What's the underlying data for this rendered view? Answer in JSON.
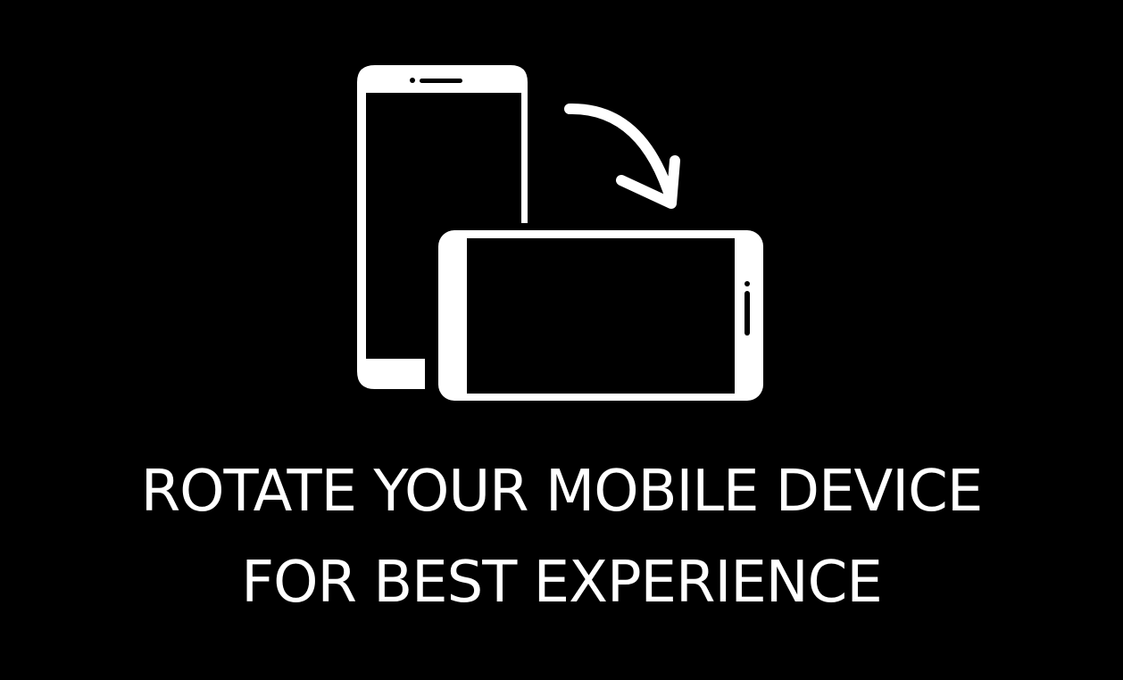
{
  "colors": {
    "background": "#000000",
    "foreground": "#ffffff"
  },
  "icons": {
    "portrait_phone": "portrait-phone-icon",
    "landscape_phone": "landscape-phone-icon",
    "rotate_arrow": "rotate-arrow-icon"
  },
  "message": {
    "line1": "ROTATE YOUR MOBILE DEVICE",
    "line2": "FOR BEST EXPERIENCE"
  }
}
